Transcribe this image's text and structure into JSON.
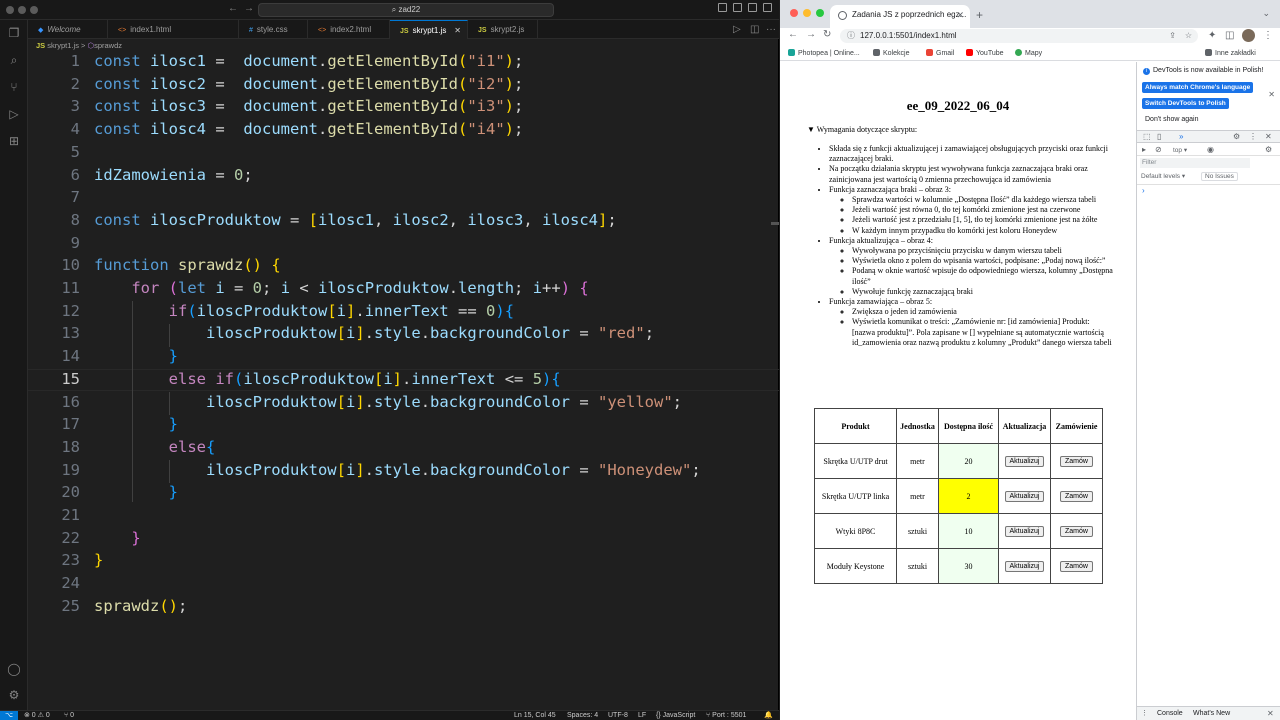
{
  "vscode": {
    "search_text": "zad22",
    "tabs": [
      {
        "label": "Welcome",
        "icon": "vscode-icon",
        "icon_color": "#3794ff"
      },
      {
        "label": "index1.html",
        "icon": "<>",
        "icon_color": "#e37933"
      },
      {
        "label": "style.css",
        "icon": "#",
        "icon_color": "#42a5f5"
      },
      {
        "label": "index2.html",
        "icon": "<>",
        "icon_color": "#e37933"
      },
      {
        "label": "skrypt1.js",
        "icon": "JS",
        "icon_color": "#cbcb41"
      },
      {
        "label": "skrypt2.js",
        "icon": "JS",
        "icon_color": "#cbcb41"
      }
    ],
    "breadcrumb": {
      "file": "skrypt1.js",
      "separator": ">",
      "symbol": "sprawdz"
    },
    "line_numbers": [
      "1",
      "2",
      "3",
      "4",
      "5",
      "6",
      "7",
      "8",
      "9",
      "10",
      "11",
      "12",
      "13",
      "14",
      "15",
      "16",
      "17",
      "18",
      "19",
      "20",
      "21",
      "22",
      "23",
      "24",
      "25"
    ],
    "status": {
      "errors": "⊗ 0 ⚠ 0",
      "ports": "⑂ 0",
      "position": "Ln 15, Col 45",
      "spaces": "Spaces: 4",
      "encoding": "UTF-8",
      "eol": "LF",
      "language": "{} JavaScript",
      "port": "⑂ Port : 5501"
    }
  },
  "chrome": {
    "tab_title": "Zadania JS z poprzednich egz...",
    "url": "127.0.0.1:5501/index1.html",
    "bookmarks": [
      "Photopea | Online...",
      "Kolekcje",
      "Gmail",
      "YouTube",
      "Mapy"
    ],
    "other_bookmarks": "Inne zakładki",
    "page": {
      "title": "ee_09_2022_06_04",
      "details_summary": "Wymagania dotyczące skryptu:",
      "requirements": [
        {
          "text": "Składa się z funkcji aktualizującej i zamawiającej obsługujących przyciski oraz funkcji zaznaczającej braki.",
          "sub": []
        },
        {
          "text": "Na początku działania skryptu jest wywoływana funkcja zaznaczająca braki oraz zainicjowana jest wartością 0 zmienna przechowująca id zamówienia",
          "sub": []
        },
        {
          "text": "Funkcja zaznaczająca braki – obraz 3:",
          "sub": [
            "Sprawdza wartości w kolumnie „Dostępna Ilość” dla każdego wiersza tabeli",
            "Jeżeli wartość jest równa 0, tło tej komórki zmienione jest na czerwone",
            "Jeżeli wartość jest z przedziału [1, 5], tło tej komórki zmienione jest na żółte",
            "W każdym innym przypadku tło komórki jest koloru Honeydew"
          ]
        },
        {
          "text": "Funkcja aktualizująca – obraz 4:",
          "sub": [
            "Wywoływana po przyciśnięciu przycisku w danym wierszu tabeli",
            "Wyświetla okno z polem do wpisania wartości, podpisane: „Podaj nową ilość:”",
            "Podaną w oknie wartość wpisuje do odpowiedniego wiersza, kolumny „Dostępna ilość”",
            "Wywołuje funkcję zaznaczającą braki"
          ]
        },
        {
          "text": "Funkcja zamawiająca – obraz 5:",
          "sub": [
            "Zwiększa o jeden id zamówienia",
            "Wyświetla komunikat o treści: „Zamówienie nr: [id zamówienia] Produkt: [nazwa produktu]”. Pola zapisane w [] wypełniane są automatycznie wartością id_zamowienia oraz nazwą produktu z kolumny „Produkt” danego wiersza tabeli"
          ]
        }
      ],
      "table": {
        "headers": [
          "Produkt",
          "Jednostka",
          "Dostępna ilość",
          "Aktualizacja",
          "Zamówienie"
        ],
        "rows": [
          {
            "product": "Skrętka U/UTP drut",
            "unit": "metr",
            "qty": "20",
            "update": "Aktualizuj",
            "order": "Zamów",
            "qty_bg": "#f0fff0"
          },
          {
            "product": "Skrętka U/UTP linka",
            "unit": "metr",
            "qty": "2",
            "update": "Aktualizuj",
            "order": "Zamów",
            "qty_bg": "#ffff00"
          },
          {
            "product": "Wtyki 8P8C",
            "unit": "sztuki",
            "qty": "10",
            "update": "Aktualizuj",
            "order": "Zamów",
            "qty_bg": "#f0fff0"
          },
          {
            "product": "Moduły Keystone",
            "unit": "sztuki",
            "qty": "30",
            "update": "Aktualizuj",
            "order": "Zamów",
            "qty_bg": "#f0fff0"
          }
        ]
      }
    },
    "devtools": {
      "notice": "DevTools is now available in Polish!",
      "btn_match": "Always match Chrome's language",
      "btn_switch": "Switch DevTools to Polish",
      "dont_show": "Don't show again",
      "context": "top ▾",
      "filter_placeholder": "Filter",
      "levels": "Default levels ▾",
      "issues": "No Issues",
      "prompt": "›",
      "tab_console": "Console",
      "tab_whatsnew": "What's New"
    }
  }
}
